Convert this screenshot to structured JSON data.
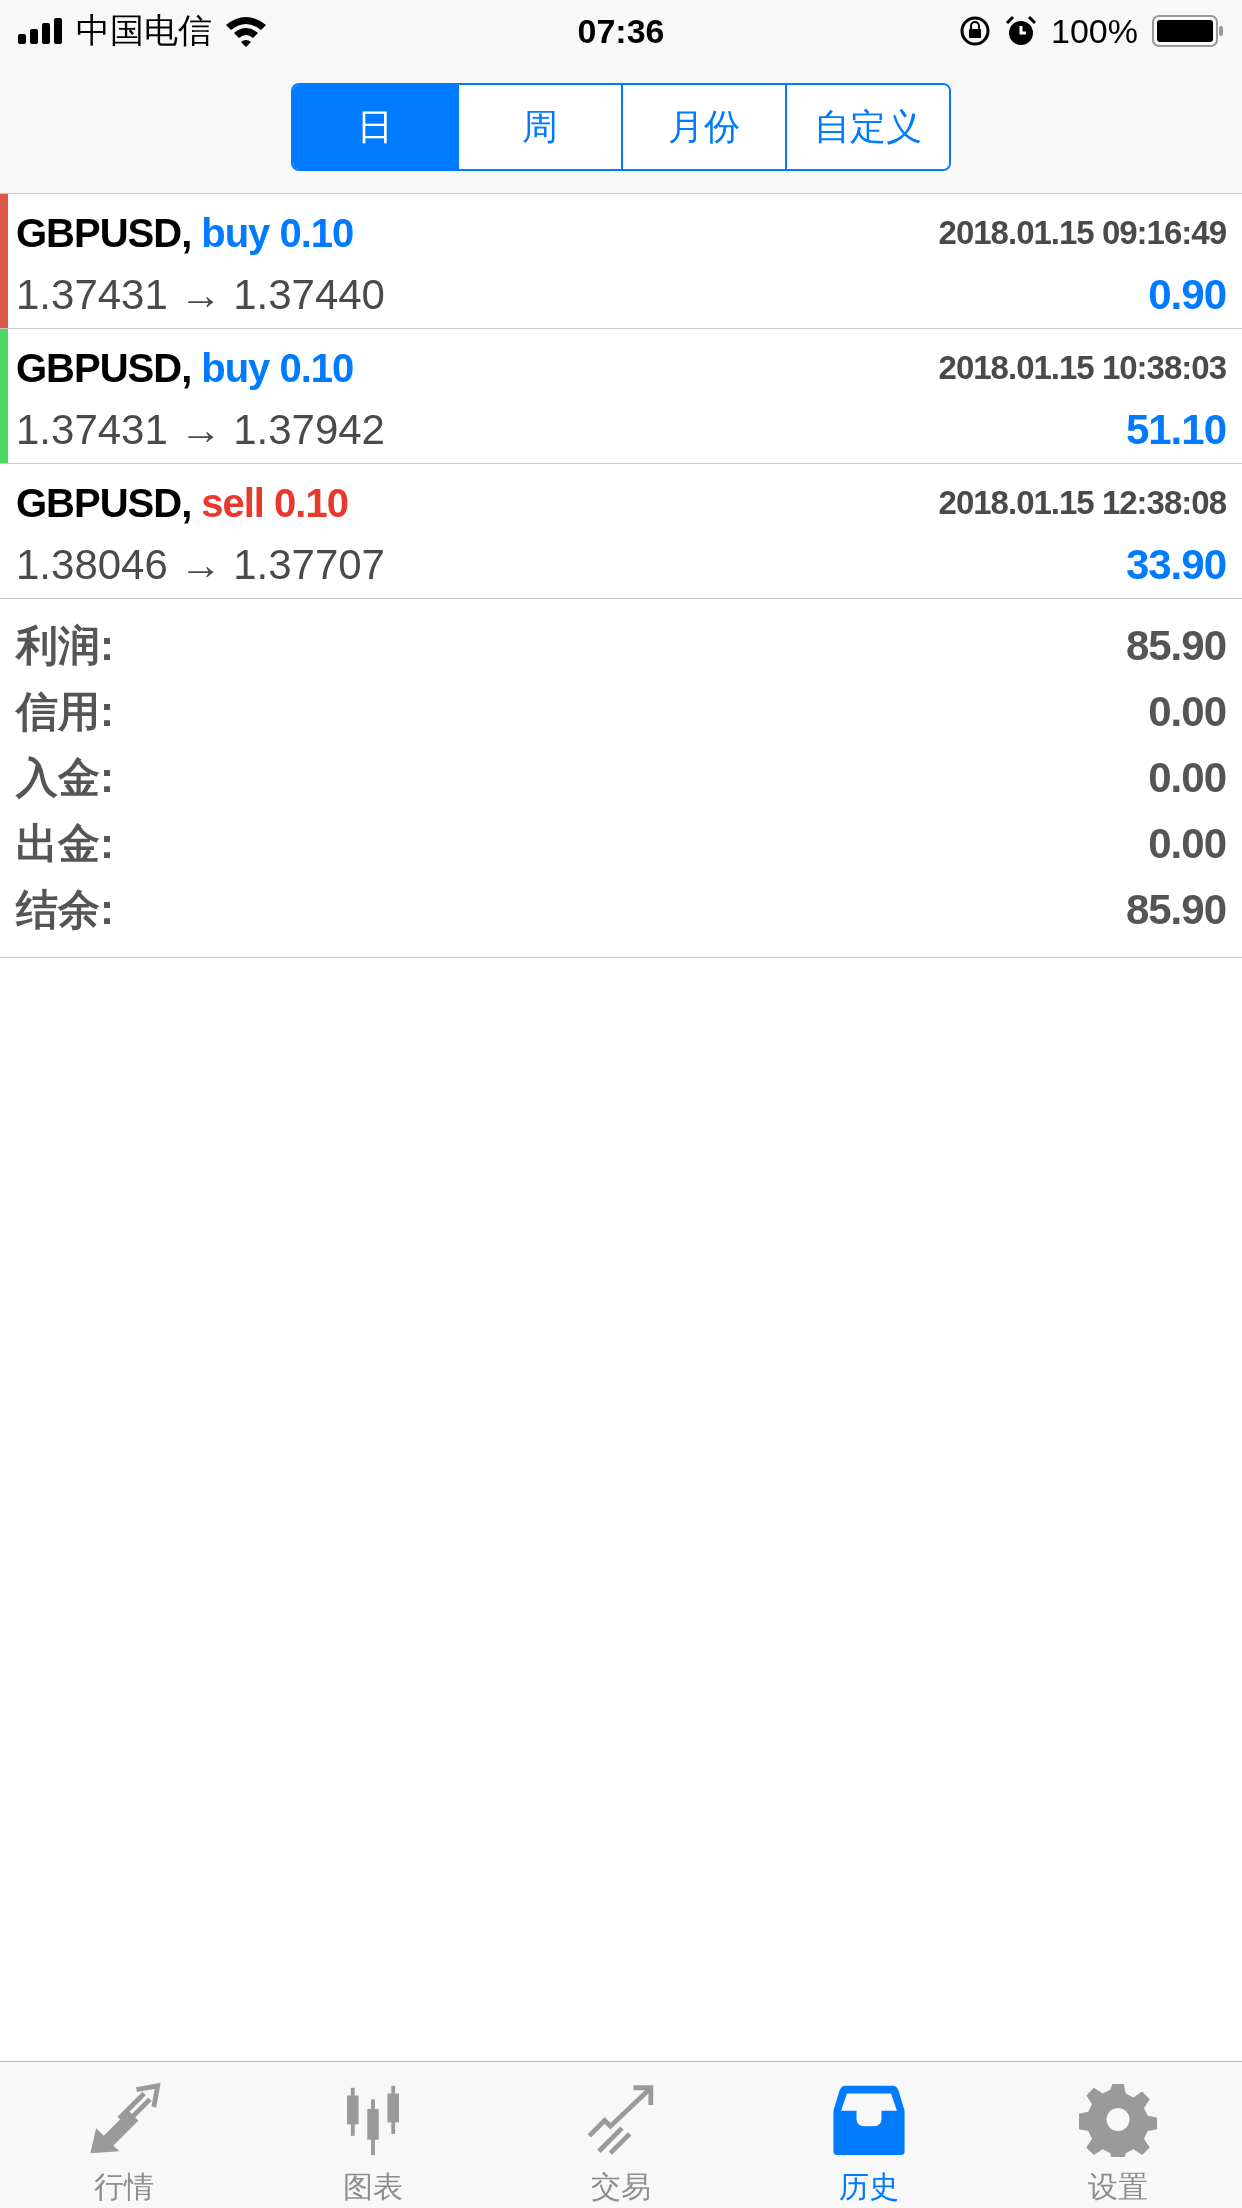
{
  "status_bar": {
    "carrier": "中国电信",
    "time": "07:36",
    "battery": "100%"
  },
  "period_tabs": [
    {
      "label": "日",
      "selected": true
    },
    {
      "label": "周",
      "selected": false
    },
    {
      "label": "月份",
      "selected": false
    },
    {
      "label": "自定义",
      "selected": false
    }
  ],
  "trades": [
    {
      "symbol": "GBPUSD,",
      "side": "buy 0.10",
      "kind": "buy",
      "time": "2018.01.15 09:16:49",
      "prices": "1.37431 → 1.37440",
      "profit": "0.90",
      "color": "#e0584c"
    },
    {
      "symbol": "GBPUSD,",
      "side": "buy 0.10",
      "kind": "buy",
      "time": "2018.01.15 10:38:03",
      "prices": "1.37431 → 1.37942",
      "profit": "51.10",
      "color": "#4cd964"
    },
    {
      "symbol": "GBPUSD,",
      "side": "sell 0.10",
      "kind": "sell",
      "time": "2018.01.15 12:38:08",
      "prices": "1.38046 → 1.37707",
      "profit": "33.90"
    }
  ],
  "summary": [
    {
      "label": "利润:",
      "value": "85.90"
    },
    {
      "label": "信用:",
      "value": "0.00"
    },
    {
      "label": "入金:",
      "value": "0.00"
    },
    {
      "label": "出金:",
      "value": "0.00"
    },
    {
      "label": "结余:",
      "value": "85.90"
    }
  ],
  "tab_bar": [
    {
      "label": "行情",
      "kind": "quotes",
      "selected": false
    },
    {
      "label": "图表",
      "kind": "chart",
      "selected": false
    },
    {
      "label": "交易",
      "kind": "trade",
      "selected": false
    },
    {
      "label": "历史",
      "kind": "history",
      "selected": true
    },
    {
      "label": "设置",
      "kind": "settings",
      "selected": false
    }
  ]
}
